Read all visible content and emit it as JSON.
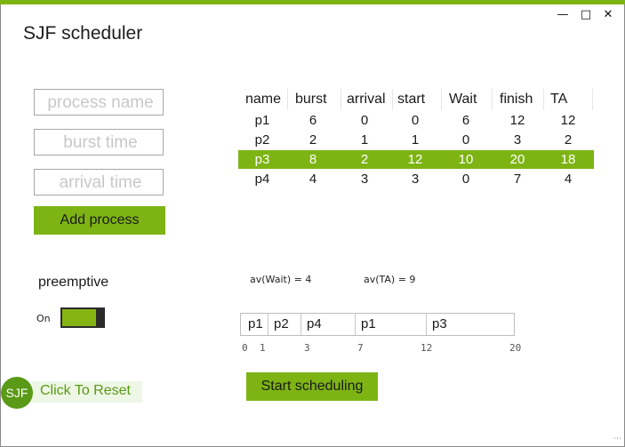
{
  "window": {
    "title": "SJF scheduler",
    "minimize": "—",
    "maximize": "□",
    "close": "✕"
  },
  "form": {
    "process_name_placeholder": "process name",
    "burst_time_placeholder": "burst time",
    "arrival_time_placeholder": "arrival time",
    "add_label": "Add process"
  },
  "options": {
    "preemptive_label": "preemptive",
    "toggle_state_label": "On",
    "preemptive": true
  },
  "table": {
    "headers": [
      "name",
      "burst",
      "arrival",
      "start",
      "Wait",
      "finish",
      "TA"
    ],
    "rows": [
      [
        "p1",
        "6",
        "0",
        "0",
        "6",
        "12",
        "12"
      ],
      [
        "p2",
        "2",
        "1",
        "1",
        "0",
        "3",
        "2"
      ],
      [
        "p3",
        "8",
        "2",
        "12",
        "10",
        "20",
        "18"
      ],
      [
        "p4",
        "4",
        "3",
        "3",
        "0",
        "7",
        "4"
      ]
    ],
    "selected_row": 2
  },
  "stats": {
    "avg_wait": "av(Wait) = 4",
    "avg_ta": "av(TA) = 9"
  },
  "gantt": {
    "segments": [
      "p1",
      "p2",
      "p4",
      "p1",
      "p3"
    ],
    "ticks": [
      "0",
      "1",
      "3",
      "7",
      "12",
      "20"
    ]
  },
  "actions": {
    "start_label": "Start scheduling",
    "reset_label": "Click To Reset",
    "logo_text": "SJF"
  },
  "colors": {
    "accent": "#7db413",
    "logo_bg": "#5a9a16",
    "toggle_track": "#2b2b2b"
  }
}
